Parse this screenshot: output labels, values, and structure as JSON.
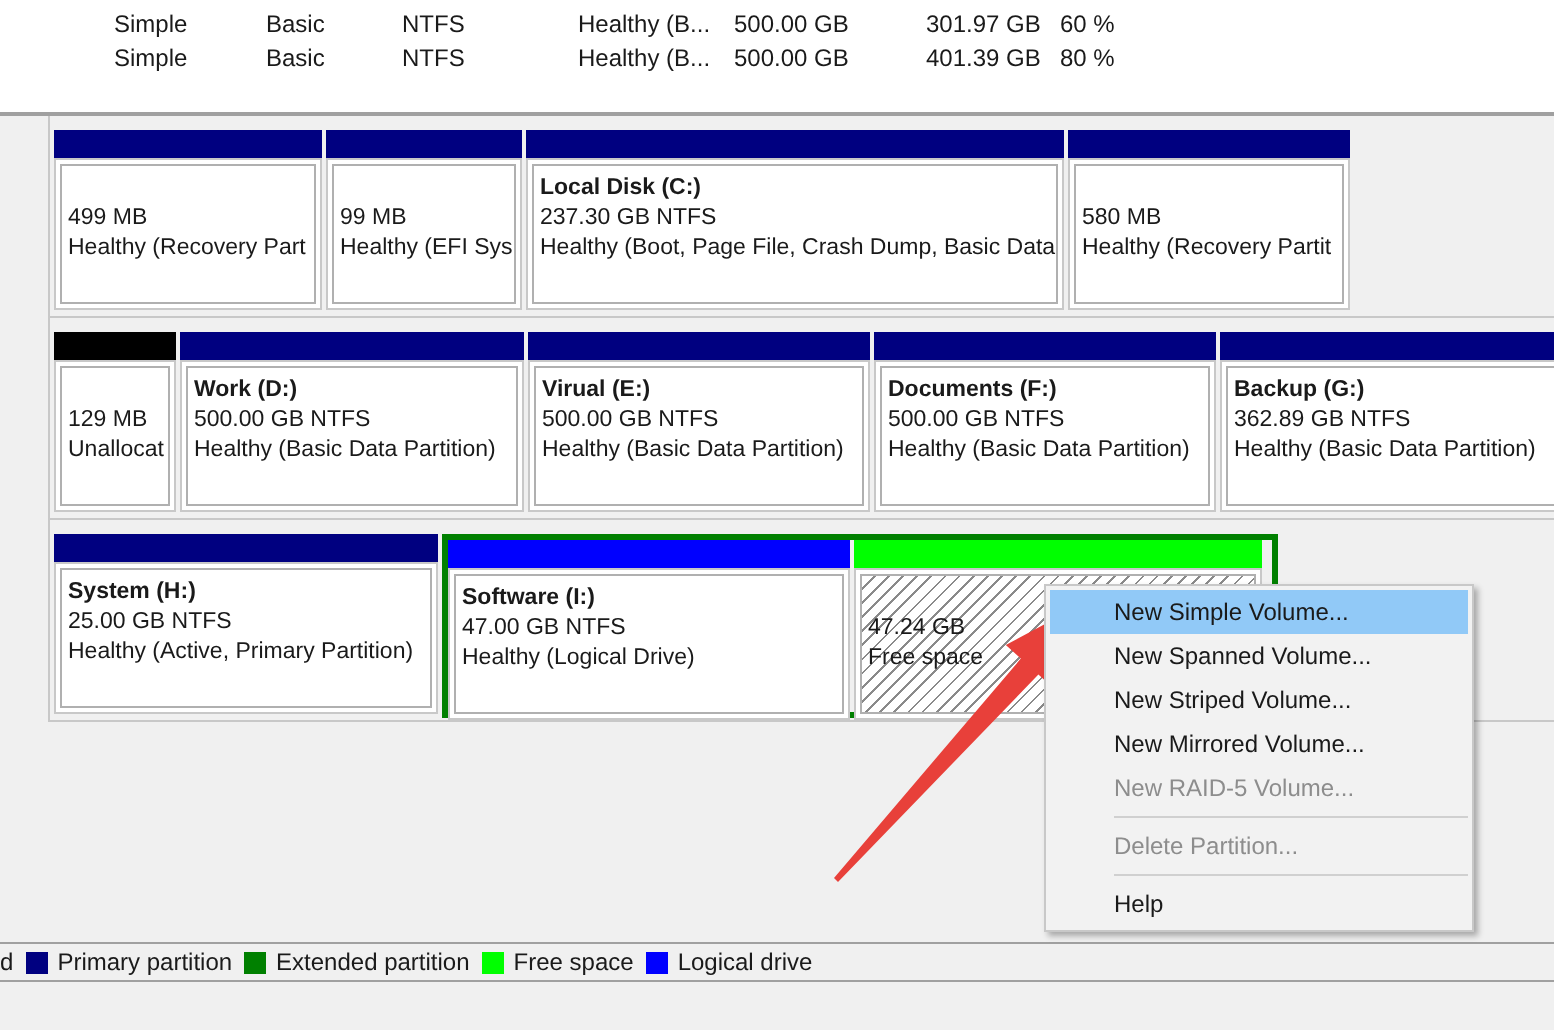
{
  "volume_table": {
    "rows": [
      {
        "cells": [
          "Simple",
          "Basic",
          "NTFS",
          "Healthy (B...",
          "500.00 GB",
          "301.97 GB",
          "60 %"
        ]
      },
      {
        "cells": [
          "Simple",
          "Basic",
          "NTFS",
          "Healthy (B...",
          "500.00 GB",
          "401.39 GB",
          "80 %"
        ]
      }
    ]
  },
  "disks": [
    {
      "partitions": [
        {
          "kind": "primary",
          "size": "499 MB",
          "status": "Healthy (Recovery Part"
        },
        {
          "kind": "primary",
          "size": "99 MB",
          "status": "Healthy (EFI Sys"
        },
        {
          "kind": "primary",
          "title": "Local Disk  (C:)",
          "size": "237.30 GB NTFS",
          "status": "Healthy (Boot, Page File, Crash Dump, Basic Data"
        },
        {
          "kind": "primary",
          "size": "580 MB",
          "status": "Healthy (Recovery Partit"
        }
      ]
    },
    {
      "partitions": [
        {
          "kind": "unallocated",
          "size": "129 MB",
          "status": "Unallocat"
        },
        {
          "kind": "primary",
          "title": "Work  (D:)",
          "size": "500.00 GB NTFS",
          "status": "Healthy (Basic Data Partition)"
        },
        {
          "kind": "primary",
          "title": "Virual  (E:)",
          "size": "500.00 GB NTFS",
          "status": "Healthy (Basic Data Partition)"
        },
        {
          "kind": "primary",
          "title": "Documents  (F:)",
          "size": "500.00 GB NTFS",
          "status": "Healthy (Basic Data Partition)"
        },
        {
          "kind": "primary",
          "title": "Backup  (G:)",
          "size": "362.89 GB NTFS",
          "status": "Healthy (Basic Data Partition)"
        }
      ]
    },
    {
      "partitions": [
        {
          "kind": "primary",
          "title": "System  (H:)",
          "size": "25.00 GB NTFS",
          "status": "Healthy (Active, Primary Partition)"
        },
        {
          "kind": "extended",
          "children": [
            {
              "kind": "logical",
              "title": "Software  (I:)",
              "size": "47.00 GB NTFS",
              "status": "Healthy (Logical Drive)"
            },
            {
              "kind": "free",
              "size": "47.24 GB",
              "status": "Free space"
            }
          ]
        }
      ]
    }
  ],
  "legend": [
    {
      "label": "d"
    },
    {
      "label": "Primary partition",
      "color": "#000080"
    },
    {
      "label": "Extended partition",
      "color": "#008000"
    },
    {
      "label": "Free space",
      "color": "#00ff00"
    },
    {
      "label": "Logical drive",
      "color": "#0000ff"
    }
  ],
  "context_menu": {
    "items": [
      {
        "kind": "item",
        "label": "New Simple Volume...",
        "selected": true,
        "disabled": false
      },
      {
        "kind": "item",
        "label": "New Spanned Volume...",
        "selected": false,
        "disabled": false
      },
      {
        "kind": "item",
        "label": "New Striped Volume...",
        "selected": false,
        "disabled": false
      },
      {
        "kind": "item",
        "label": "New Mirrored Volume...",
        "selected": false,
        "disabled": false
      },
      {
        "kind": "item",
        "label": "New RAID-5 Volume...",
        "selected": false,
        "disabled": true
      },
      {
        "kind": "separator"
      },
      {
        "kind": "item",
        "label": "Delete Partition...",
        "selected": false,
        "disabled": true
      },
      {
        "kind": "separator"
      },
      {
        "kind": "item",
        "label": "Help",
        "selected": false,
        "disabled": false
      }
    ]
  }
}
